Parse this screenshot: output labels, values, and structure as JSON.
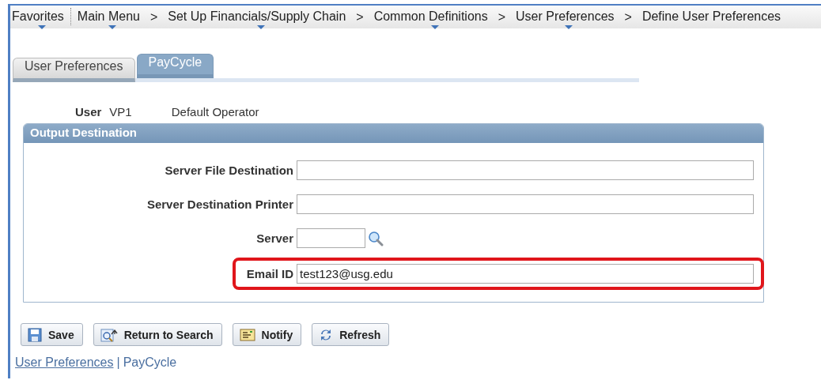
{
  "breadcrumbs": [
    {
      "label": "Favorites",
      "has_menu": true
    },
    {
      "label": "Main Menu",
      "has_menu": true
    },
    {
      "label": "Set Up Financials/Supply Chain",
      "has_menu": true,
      "separator_before": ">"
    },
    {
      "label": "Common Definitions",
      "has_menu": true,
      "separator_before": ">"
    },
    {
      "label": "User Preferences",
      "has_menu": true,
      "separator_before": ">"
    },
    {
      "label": "Define User Preferences",
      "has_menu": false,
      "separator_before": ">"
    }
  ],
  "tabs": [
    {
      "label": "User Preferences",
      "selected": false
    },
    {
      "label": "PayCycle",
      "selected": true
    }
  ],
  "user": {
    "label": "User",
    "id": "VP1",
    "description": "Default Operator"
  },
  "group": {
    "title": "Output Destination",
    "fields": [
      {
        "label": "Server File Destination",
        "kind": "wide",
        "highlighted": false
      },
      {
        "label": "Server Destination Printer",
        "kind": "wide",
        "highlighted": false
      },
      {
        "label": "Server",
        "kind": "lookup",
        "highlighted": false
      },
      {
        "label": "Email ID",
        "value": "test123@usg.edu",
        "kind": "wide",
        "highlighted": true
      }
    ]
  },
  "buttons": [
    {
      "label": "Save",
      "kind": "save"
    },
    {
      "label": "Return to Search",
      "kind": "return"
    },
    {
      "label": "Notify",
      "kind": "notify"
    },
    {
      "label": "Refresh",
      "kind": "refresh"
    }
  ],
  "footer_links": [
    {
      "label": "User Preferences",
      "selected": false
    },
    {
      "label": "PayCycle",
      "selected": true
    }
  ],
  "footer_separator": "|"
}
